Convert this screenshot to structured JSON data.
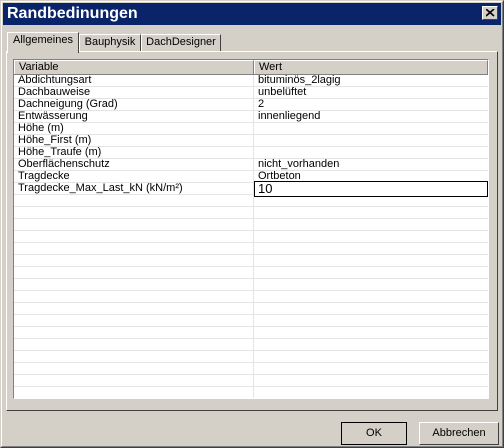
{
  "window": {
    "title": "Randbedinungen"
  },
  "tabs": [
    {
      "label": "Allgemeines"
    },
    {
      "label": "Bauphysik"
    },
    {
      "label": "DachDesigner"
    }
  ],
  "grid": {
    "columns": [
      "Variable",
      "Wert"
    ],
    "rows": [
      {
        "variable": "Abdichtungsart",
        "value": "bituminös_2lagig"
      },
      {
        "variable": "Dachbauweise",
        "value": "unbelüftet"
      },
      {
        "variable": "Dachneigung (Grad)",
        "value": "2"
      },
      {
        "variable": "Entwässerung",
        "value": "innenliegend"
      },
      {
        "variable": "Höhe (m)",
        "value": ""
      },
      {
        "variable": "Höhe_First (m)",
        "value": ""
      },
      {
        "variable": "Höhe_Traufe (m)",
        "value": ""
      },
      {
        "variable": "Oberflächenschutz",
        "value": "nicht_vorhanden"
      },
      {
        "variable": "Tragdecke",
        "value": "Ortbeton"
      },
      {
        "variable": "Tragdecke_Max_Last_kN (kN/m²)",
        "value": "10"
      }
    ]
  },
  "buttons": {
    "ok": "OK",
    "cancel": "Abbrechen"
  }
}
